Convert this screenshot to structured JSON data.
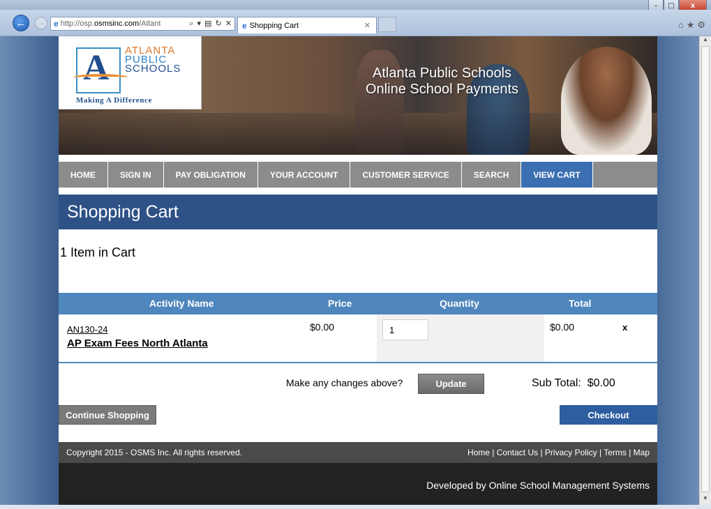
{
  "browser": {
    "address_prefix": "http://osp.",
    "address_host": "osmsinc.com",
    "address_suffix": "/Atlant",
    "address_tools": "⌕ ▾ ▤ ↻ ✕",
    "tab_title": "Shopping Cart"
  },
  "logo": {
    "line1": "ATLANTA",
    "line2": "PUBLIC",
    "line3": "SCHOOLS",
    "tagline": "Making A Difference"
  },
  "banner": {
    "line1": "Atlanta Public Schools",
    "line2": "Online School Payments"
  },
  "menu": [
    {
      "label": "HOME"
    },
    {
      "label": "SIGN IN"
    },
    {
      "label": "PAY OBLIGATION"
    },
    {
      "label": "YOUR ACCOUNT"
    },
    {
      "label": "CUSTOMER SERVICE"
    },
    {
      "label": "SEARCH"
    },
    {
      "label": "VIEW CART"
    }
  ],
  "page_title": "Shopping Cart",
  "items_count": "1 Item in Cart",
  "cart_headers": {
    "activity": "Activity Name",
    "price": "Price",
    "quantity": "Quantity",
    "total": "Total"
  },
  "cart_item": {
    "code": "AN130-24",
    "name": "AP Exam Fees North Atlanta",
    "price": "$0.00",
    "quantity": "1",
    "total": "$0.00",
    "remove": "x"
  },
  "changes_label": "Make any changes above?",
  "update_label": "Update",
  "subtotal_label": "Sub Total:",
  "subtotal_value": "$0.00",
  "continue_label": "Continue Shopping",
  "checkout_label": "Checkout",
  "footer": {
    "copyright": "Copyright 2015 - OSMS Inc. All rights reserved.",
    "links": [
      "Home",
      "Contact Us",
      "Privacy Policy",
      "Terms",
      "Map"
    ],
    "developer": "Developed by Online School Management Systems"
  },
  "colors": {
    "header_blue": "#2e5186",
    "table_head_blue": "#4f86bd",
    "menu_gray": "#8c8c8c",
    "active_menu": "#3b6fb2"
  }
}
